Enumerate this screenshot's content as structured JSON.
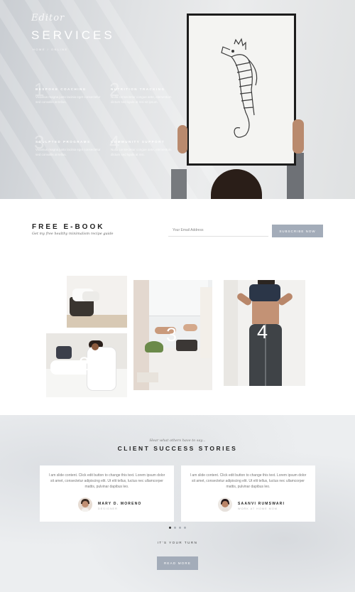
{
  "hero": {
    "signature": "Editor",
    "title": "SERVICES",
    "subtitle": "HOME / ONLINE",
    "services": [
      {
        "number": "1",
        "title": "BESPOKE COACHING",
        "desc": "Vivamus magna justo lacinia eget consectetur sed convallis at tellus."
      },
      {
        "number": "2",
        "title": "NUTRITION TRACKING",
        "desc": "Nulla consectetur congue ante, elementum dictum sed ligula at nisi sit ipsum."
      },
      {
        "number": "3",
        "title": "SCULPTED PROGRAMS",
        "desc": "Vivamus magna justo lacinia eget consectetur sed convallis at tellus."
      },
      {
        "number": "4",
        "title": "COMMUNITY SUPPORT",
        "desc": "Nulla consectetur congue ante, elementum dictum sed ligula at nisi."
      }
    ]
  },
  "ebook": {
    "title": "FREE E-BOOK",
    "subtitle": "Get my free healthy minimalism recipe guide",
    "email_placeholder": "Your Email Address",
    "subscribe_label": "SUBSCRIBE NOW"
  },
  "collage": {
    "tiles": [
      {
        "number": ""
      },
      {
        "number": "2"
      },
      {
        "number": "3"
      },
      {
        "number": "4"
      }
    ]
  },
  "testimonials": {
    "kicker": "Hear what others have to say...",
    "title": "CLIENT SUCCESS STORIES",
    "cards": [
      {
        "quote": "I am slide content. Click edit button to change this text. Lorem ipsum dolor sit amet, consectetur adipiscing elit. Ut elit tellus, luctus nec ullamcorper mattis, pulvinar dapibus leo.",
        "name": "MARY D. MORENO",
        "role": "DESIGNER"
      },
      {
        "quote": "I am slide content. Click edit button to change this text. Lorem ipsum dolor sit amet, consectetur adipiscing elit. Ut elit tellus, luctus nec ullamcorper mattis, pulvinar dapibus leo.",
        "name": "SAANVI RUMSWARI",
        "role": "WORK AT HOME MOM"
      }
    ],
    "carousel": {
      "active": 1,
      "total": 4
    },
    "cta_text": "IT'S YOUR TURN",
    "read_more_label": "READ MORE"
  },
  "colors": {
    "accent": "#a3acb9",
    "text_dark": "#222222",
    "text_muted": "#777777"
  }
}
